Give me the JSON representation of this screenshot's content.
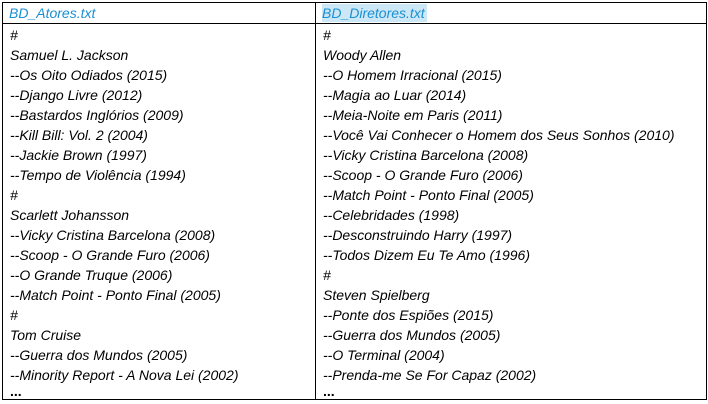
{
  "colors": {
    "header_text": "#1a8fd1",
    "header_highlight": "#cce8f7",
    "border": "#000000",
    "text": "#000000"
  },
  "left": {
    "filename": "BD_Atores.txt",
    "lines": [
      "#",
      "Samuel L. Jackson",
      "--Os Oito Odiados (2015)",
      "--Django Livre (2012)",
      "--Bastardos Inglórios (2009)",
      "--Kill Bill: Vol. 2 (2004)",
      "--Jackie Brown (1997)",
      "--Tempo de Violência (1994)",
      "#",
      "Scarlett Johansson",
      "--Vicky Cristina Barcelona (2008)",
      "--Scoop - O Grande Furo (2006)",
      "--O Grande Truque (2006)",
      "--Match Point - Ponto Final (2005)",
      "#",
      "Tom Cruise",
      "--Guerra dos Mundos (2005)",
      "--Minority Report - A Nova Lei (2002)"
    ],
    "ellipsis": "..."
  },
  "right": {
    "filename": "BD_Diretores.txt",
    "lines": [
      "#",
      "Woody Allen",
      "--O Homem Irracional (2015)",
      "--Magia ao Luar (2014)",
      "--Meia-Noite em Paris (2011)",
      "--Você Vai Conhecer o Homem dos Seus Sonhos (2010)",
      "--Vicky Cristina Barcelona (2008)",
      "--Scoop - O Grande Furo (2006)",
      "--Match Point - Ponto Final (2005)",
      "--Celebridades (1998)",
      "--Desconstruindo Harry (1997)",
      "--Todos Dizem Eu Te Amo (1996)",
      "#",
      "Steven Spielberg",
      "--Ponte dos Espiões (2015)",
      "--Guerra dos Mundos (2005)",
      "--O Terminal (2004)",
      "--Prenda-me Se For Capaz (2002)"
    ],
    "ellipsis": "..."
  }
}
